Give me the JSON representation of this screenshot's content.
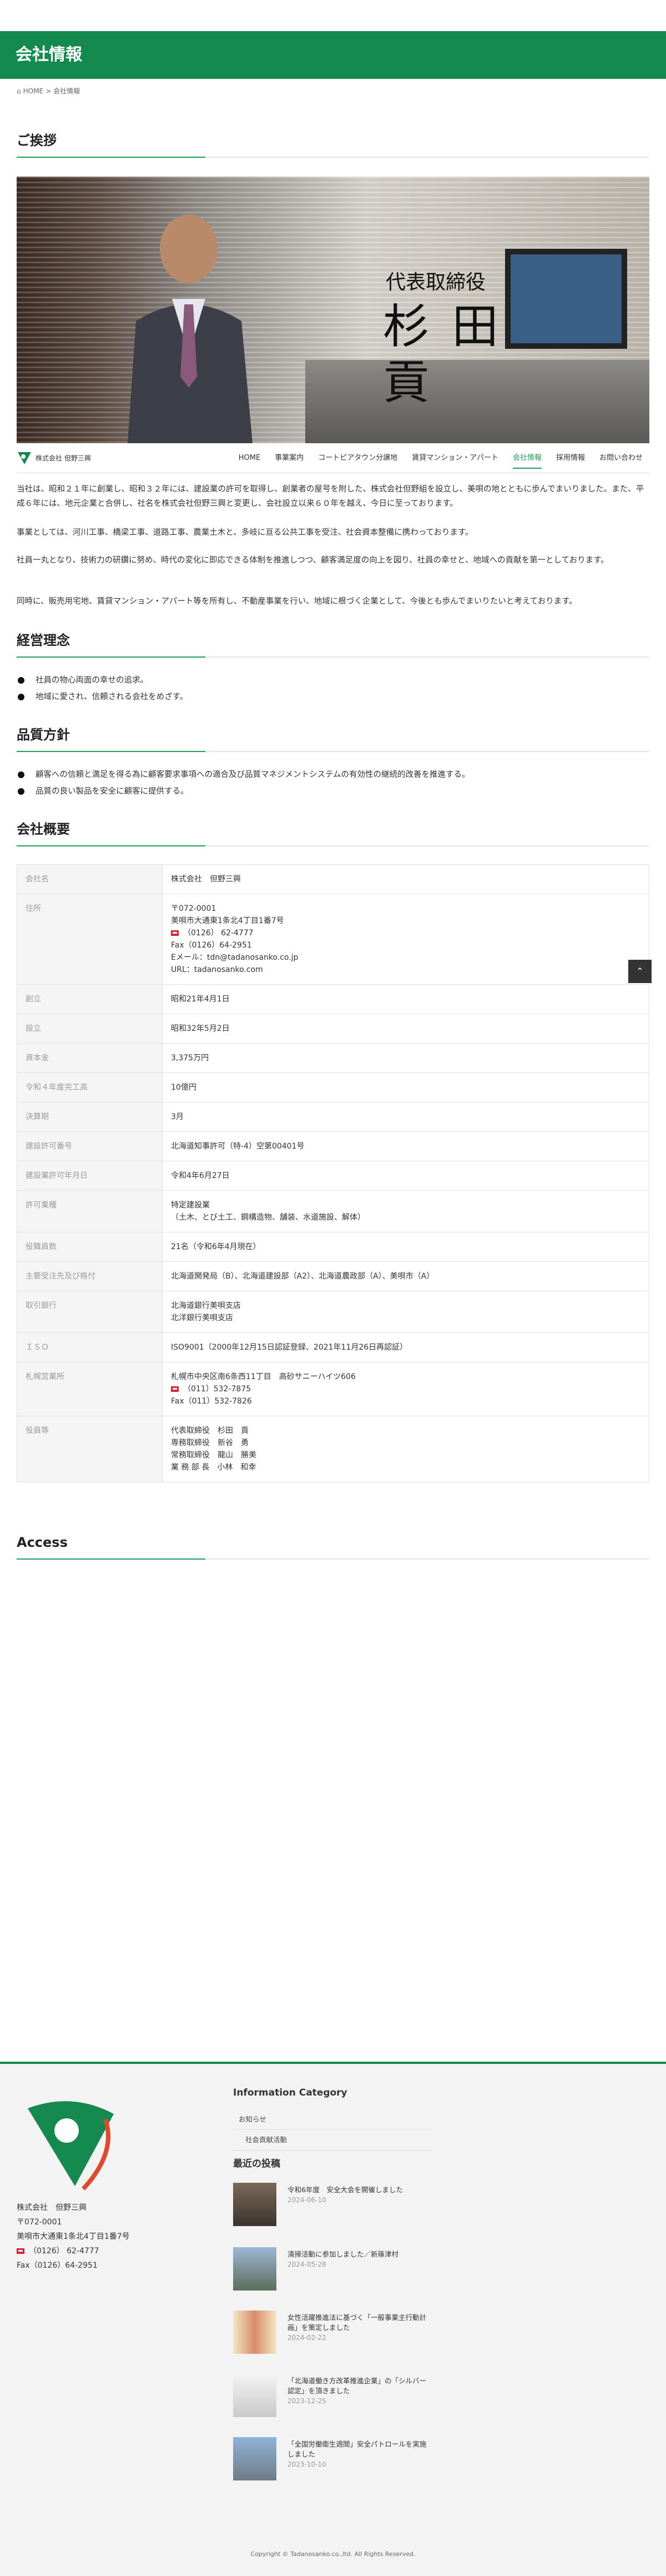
{
  "page": {
    "title": "会社情報",
    "breadcrumb": [
      "HOME",
      "会社情報"
    ]
  },
  "greeting": {
    "heading": "ご挨拶",
    "role": "代表取締役",
    "name": "杉田　貢",
    "paragraphs": [
      "当社は、昭和２１年に創業し、昭和３２年には、建設業の許可を取得し、創業者の屋号を附した、株式会社但野組を設立し、美唄の地とともに歩んでまいりました。また、平成６年には、地元企業と合併し、社名を株式会社但野三興と変更し、会社設立以来６０年を越え、今日に至っております。",
      "事業としては、河川工事、橋梁工事、道路工事、農業土木と、多岐に亘る公共工事を受注、社会資本整備に携わっております。",
      "社員一丸となり、技術力の研鑽に努め、時代の変化に即応できる体制を推進しつつ、顧客満足度の向上を図り、社員の幸せと、地域への貢献を第一としております。",
      "同時に、販売用宅地、賃貸マンション・アパート等を所有し、不動産事業を行い、地域に根づく企業として、今後とも歩んでまいりたいと考えております。"
    ]
  },
  "nav": {
    "logo_text": "株式会社 但野三興",
    "items": [
      "HOME",
      "事業案内",
      "コートピアタウン分譲地",
      "賃貸マンション・アパート",
      "会社情報",
      "採用情報",
      "お問い合わせ"
    ],
    "active": "会社情報"
  },
  "philosophy": {
    "heading": "経営理念",
    "items": [
      "社員の物心両面の幸せの追求。",
      "地域に愛され、信頼される会社をめざす。"
    ]
  },
  "quality": {
    "heading": "品質方針",
    "items": [
      "顧客への信頼と満足を得る為に顧客要求事項への適合及び品質マネジメントシステムの有効性の継続的改善を推進する。",
      "品質の良い製品を安全に顧客に提供する。"
    ]
  },
  "overview": {
    "heading": "会社概要",
    "rows": [
      {
        "label": "会社名",
        "lines": [
          "株式会社　但野三興"
        ]
      },
      {
        "label": "住所",
        "lines": [
          "〒072-0001",
          "美唄市大通東1条北4丁目1番7号",
          "MAIL:（0126） 62-4777",
          "Fax（0126）64-2951",
          "Eメール：tdn@tadanosanko.co.jp",
          "URL：tadanosanko.com"
        ]
      },
      {
        "label": "創立",
        "lines": [
          "昭和21年4月1日"
        ]
      },
      {
        "label": "設立",
        "lines": [
          "昭和32年5月2日"
        ]
      },
      {
        "label": "資本金",
        "lines": [
          "3,375万円"
        ]
      },
      {
        "label": "令和４年度完工高",
        "lines": [
          "10億円"
        ]
      },
      {
        "label": "決算期",
        "lines": [
          "3月"
        ]
      },
      {
        "label": "建設許可番号",
        "lines": [
          "北海道知事許可（特-4）空第00401号"
        ]
      },
      {
        "label": "建設業許可年月日",
        "lines": [
          "令和4年6月27日"
        ]
      },
      {
        "label": "許可業種",
        "lines": [
          "特定建設業",
          "（土木、とび土工、鋼構造物、舗装、水道施設、解体）"
        ]
      },
      {
        "label": "役職員数",
        "lines": [
          "21名（令和6年4月現在）"
        ]
      },
      {
        "label": "主要受注先及び格付",
        "lines": [
          "北海道開発局（B）、北海道建設部（A2）、北海道農政部（A）、美唄市（A）"
        ]
      },
      {
        "label": "取引銀行",
        "lines": [
          "北海道銀行美唄支店",
          "北洋銀行美唄支店"
        ]
      },
      {
        "label": "ＩＳＯ",
        "lines": [
          "ISO9001（2000年12月15日認証登録、2021年11月26日再認証）"
        ]
      },
      {
        "label": "札幌営業所",
        "lines": [
          "札幌市中央区南6条西11丁目　高砂サニーハイツ606",
          "MAIL:（011）532-7875",
          "Fax（011）532-7826"
        ]
      },
      {
        "label": "役員等",
        "lines": [
          "代表取締役　杉田　貢",
          "専務取締役　新谷　勇",
          "常務取締役　龍山　勝美",
          "業 務 部 長　小林　和幸"
        ]
      }
    ]
  },
  "access": {
    "heading": "Access"
  },
  "footer": {
    "company": "株式会社　但野三興",
    "zip": "〒072-0001",
    "address": "美唄市大通東1条北4丁目1番7号",
    "tel": "（0126） 62-4777",
    "fax": "Fax（0126）64-2951",
    "category_heading": "Information Category",
    "categories": [
      "お知らせ",
      "社会貢献活動"
    ],
    "recent_heading": "最近の投稿",
    "posts": [
      {
        "title": "令和6年度　安全大会を開催しました",
        "date": "2024-06-10"
      },
      {
        "title": "清掃活動に参加しました／新篠津村",
        "date": "2024-05-28"
      },
      {
        "title": "女性活躍推進法に基づく「一般事業主行動計画」を策定しました",
        "date": "2024-02-22"
      },
      {
        "title": "「北海道働き方改革推進企業」の「シルバー認定」を頂きました",
        "date": "2023-12-25"
      },
      {
        "title": "「全国労働衛生週間」安全パトロールを実施しました",
        "date": "2023-10-10"
      }
    ],
    "copyright": "Copyright © Tadanosanko.co.,ltd. All Rights Reserved."
  },
  "colors": {
    "brand_green": "#158a4f",
    "accent_green": "#1f9e5c",
    "mail_red": "#d9232e"
  },
  "icons": [
    "mail-icon",
    "arrow-up-icon",
    "company-logo-icon"
  ]
}
